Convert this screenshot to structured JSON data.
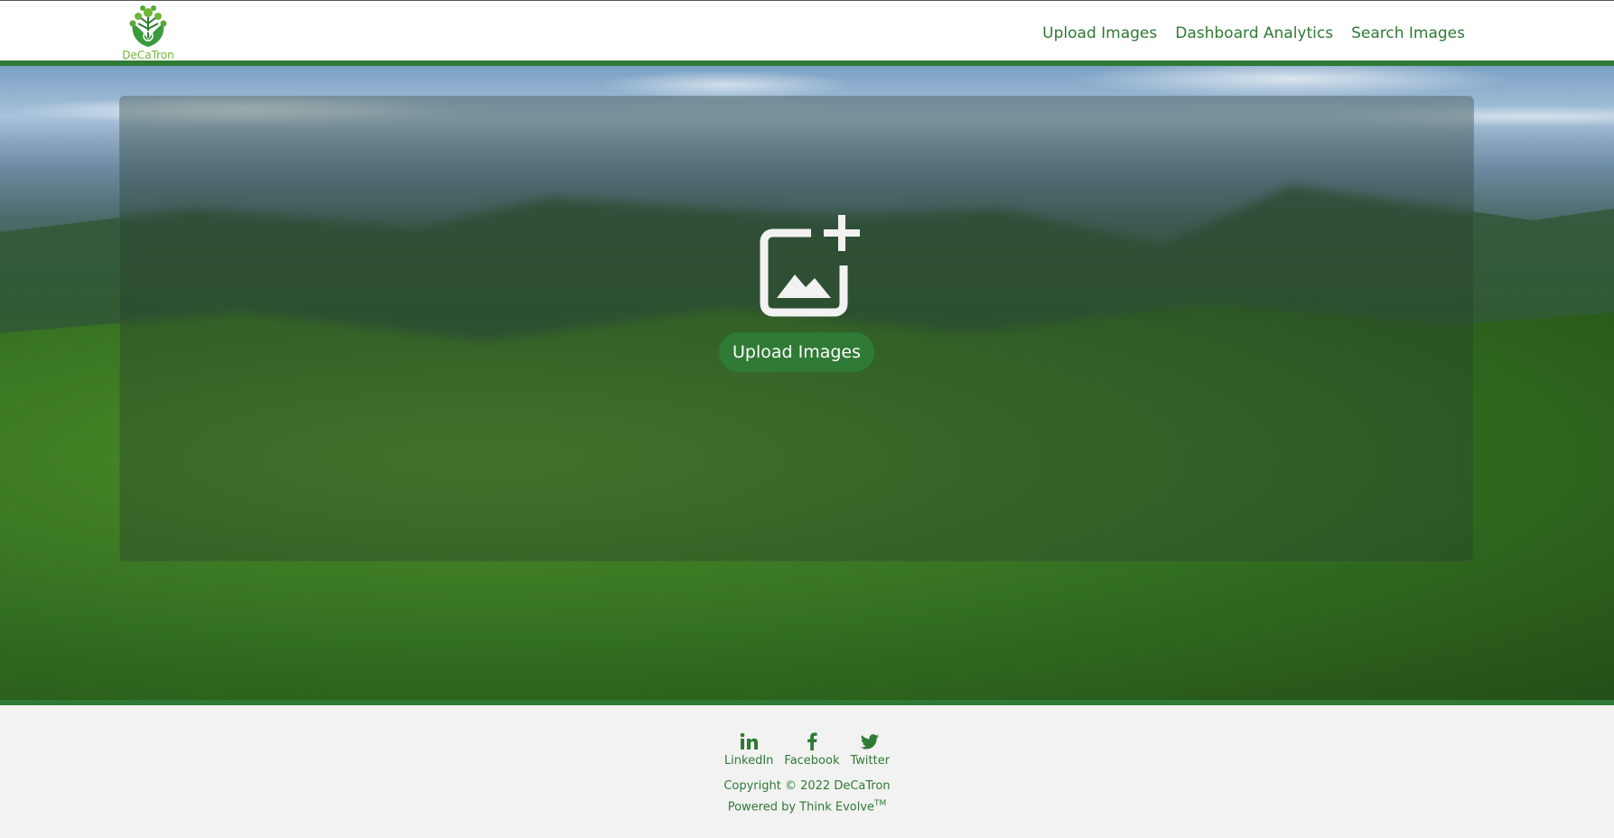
{
  "header": {
    "logo_text": "DeCaTron",
    "nav": [
      {
        "label": "Upload Images"
      },
      {
        "label": "Dashboard Analytics"
      },
      {
        "label": "Search Images"
      }
    ]
  },
  "main": {
    "upload_button_label": "Upload Images",
    "upload_icon": "add-image-icon"
  },
  "footer": {
    "social": [
      {
        "label": "LinkedIn",
        "icon": "linkedin-icon"
      },
      {
        "label": "Facebook",
        "icon": "facebook-icon"
      },
      {
        "label": "Twitter",
        "icon": "twitter-icon"
      }
    ],
    "copyright": "Copyright © 2022 DeCaTron",
    "powered_by": "Powered by Think Evolve",
    "trademark": "TM"
  },
  "colors": {
    "brand_green": "#2f7a34",
    "logo_green": "#6fb63a",
    "footer_bg": "#f2f2f2"
  }
}
